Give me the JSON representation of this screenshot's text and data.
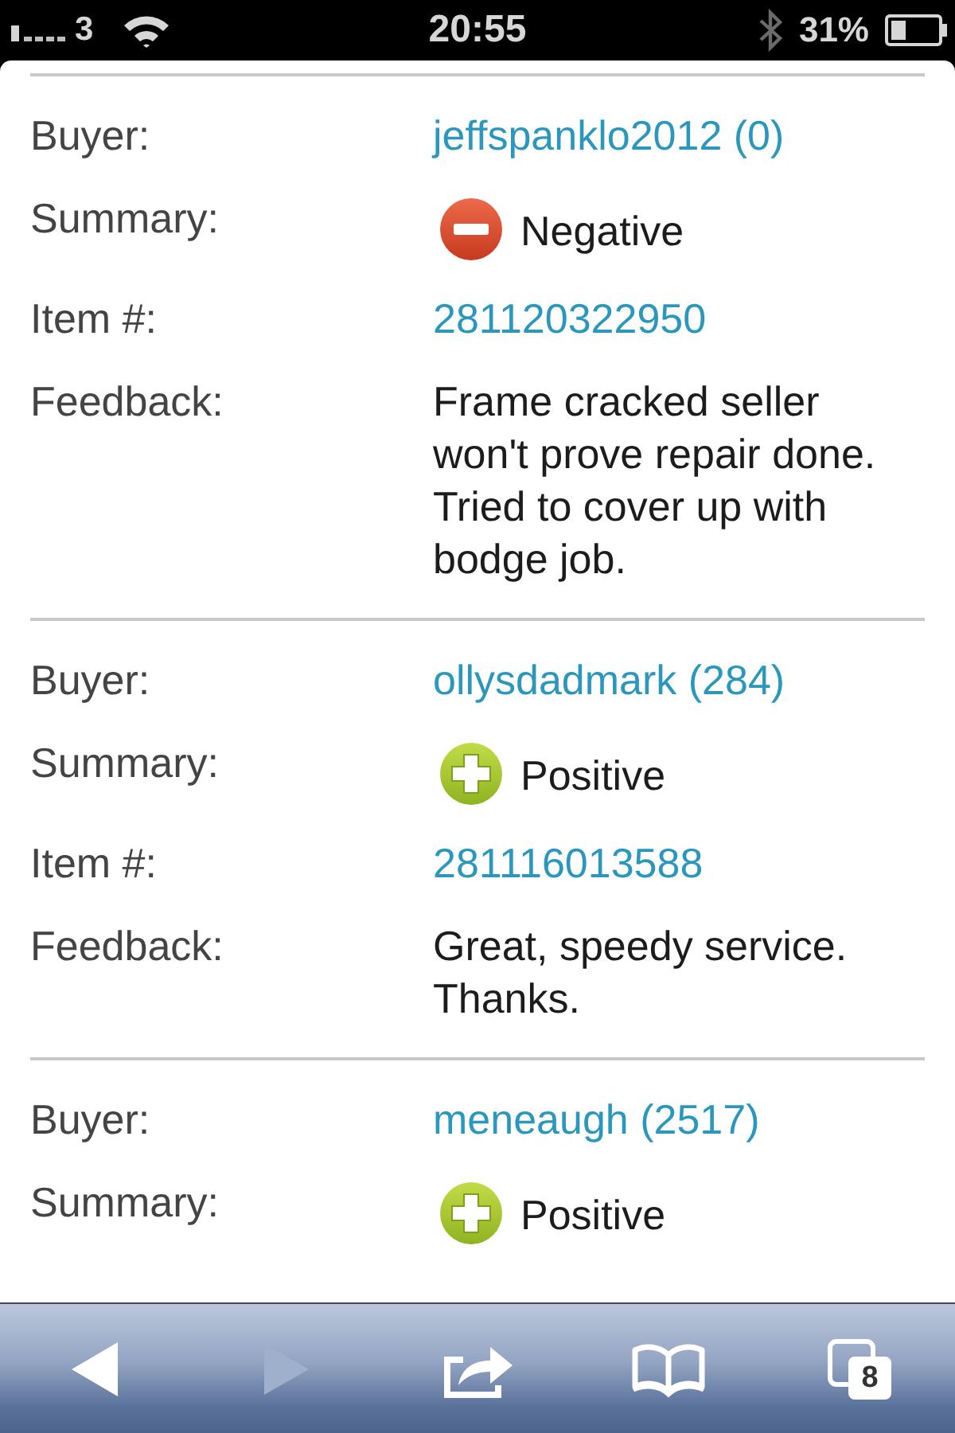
{
  "status_bar": {
    "carrier": "3",
    "time": "20:55",
    "battery": "31%"
  },
  "entries": [
    {
      "rows": [
        {
          "kind": "buyer",
          "label": "Buyer:",
          "value": "jeffspanklo2012 (0)"
        },
        {
          "kind": "rating",
          "label": "Summary:",
          "value": "Negative",
          "positive": false
        },
        {
          "kind": "item",
          "label": "Item #:",
          "value": "281120322950"
        },
        {
          "kind": "comment",
          "label": "Feedback:",
          "value": "Frame cracked seller won't prove repair done. Tried to cover up with bodge job."
        }
      ]
    },
    {
      "rows": [
        {
          "kind": "buyer",
          "label": "Buyer:",
          "value": "ollysdadmark (284)"
        },
        {
          "kind": "rating",
          "label": "Summary:",
          "value": "Positive",
          "positive": true
        },
        {
          "kind": "item",
          "label": "Item #:",
          "value": "281116013588"
        },
        {
          "kind": "comment",
          "label": "Feedback:",
          "value": "Great, speedy service. Thanks."
        }
      ]
    },
    {
      "rows": [
        {
          "kind": "buyer",
          "label": "Buyer:",
          "value": "meneaugh (2517)"
        },
        {
          "kind": "rating",
          "label": "Summary:",
          "value": "Positive",
          "positive": true
        }
      ]
    }
  ],
  "toolbar": [
    {
      "kind": "back",
      "disabled": false
    },
    {
      "kind": "forward",
      "disabled": true
    },
    {
      "kind": "share",
      "disabled": false
    },
    {
      "kind": "bookmarks",
      "disabled": false
    },
    {
      "kind": "tabs",
      "disabled": false,
      "count": "8"
    }
  ]
}
